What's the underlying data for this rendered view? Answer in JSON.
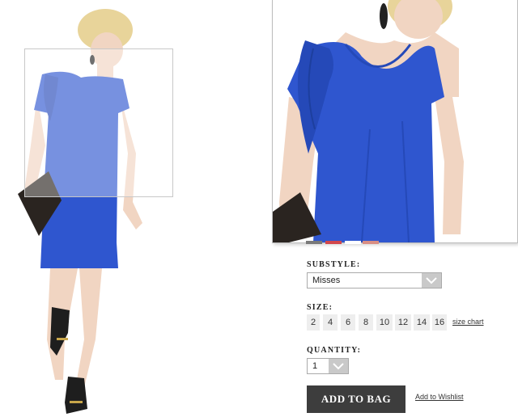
{
  "colors": {
    "dress_blue": "#2f56cf",
    "button_dark": "#3d3d3d",
    "swatches": [
      "#7a7a7a",
      "#d2474c",
      "#ffffff",
      "#d98e84"
    ]
  },
  "product_image": {
    "alt_icon": "model-photo"
  },
  "substyle": {
    "label": "SUBSTYLE:",
    "selected": "Misses"
  },
  "size": {
    "label": "SIZE:",
    "options": [
      "2",
      "4",
      "6",
      "8",
      "10",
      "12",
      "14",
      "16"
    ],
    "chart_link": "size chart"
  },
  "quantity": {
    "label": "QUANTITY:",
    "selected": "1"
  },
  "actions": {
    "add_to_bag": "ADD TO BAG",
    "wishlist": "Add to Wishlist"
  }
}
